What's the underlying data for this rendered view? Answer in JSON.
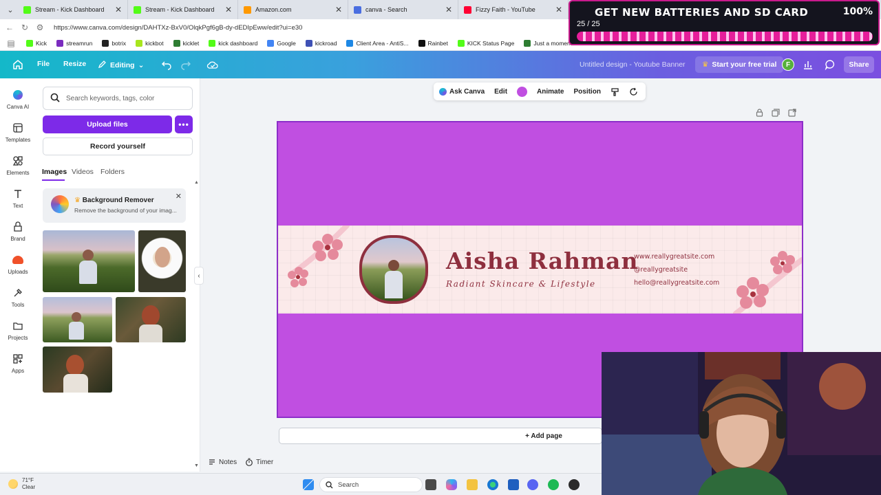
{
  "browser": {
    "tabs": [
      {
        "title": "Stream - Kick Dashboard",
        "color": "#53fc18"
      },
      {
        "title": "Stream - Kick Dashboard",
        "color": "#53fc18"
      },
      {
        "title": "Amazon.com",
        "color": "#ff9900"
      },
      {
        "title": "canva - Search",
        "color": "#4a6ee0"
      },
      {
        "title": "Fizzy Faith - YouTube",
        "color": "#ff0033"
      }
    ],
    "url": "https://www.canva.com/design/DAHTXz-BxV0/OlqkPgf6gB-dy-dEDIpEww/edit?ui=e30",
    "bookmarks": [
      {
        "label": "Kick",
        "color": "#53fc18"
      },
      {
        "label": "streamrun",
        "color": "#7b2cbf"
      },
      {
        "label": "botrix",
        "color": "#222222"
      },
      {
        "label": "kickbot",
        "color": "#a8e61d"
      },
      {
        "label": "kicklet",
        "color": "#2e7d32"
      },
      {
        "label": "kick dashboard",
        "color": "#53fc18"
      },
      {
        "label": "Google",
        "color": "#4285f4"
      },
      {
        "label": "kickroad",
        "color": "#3f51b5"
      },
      {
        "label": "Client Area - AntiS...",
        "color": "#1e88e5"
      },
      {
        "label": "Rainbet",
        "color": "#111111"
      },
      {
        "label": "KICK Status Page",
        "color": "#53fc18"
      },
      {
        "label": "Just a moment...",
        "color": "#2e7d32"
      }
    ]
  },
  "overlay": {
    "headline": "GET NEW BATTERIES AND SD CARD",
    "percent": "100%",
    "count": "25 / 25",
    "progress": 1.0
  },
  "header": {
    "file": "File",
    "resize": "Resize",
    "editing": "Editing",
    "design_title": "Untitled design - Youtube Banner",
    "trial": "Start your free trial",
    "avatar_initial": "F",
    "share": "Share"
  },
  "rail": [
    {
      "label": "Canva AI",
      "icon": "canva-ai-icon"
    },
    {
      "label": "Templates",
      "icon": "templates-icon"
    },
    {
      "label": "Elements",
      "icon": "elements-icon"
    },
    {
      "label": "Text",
      "icon": "text-icon"
    },
    {
      "label": "Brand",
      "icon": "brand-icon"
    },
    {
      "label": "Uploads",
      "icon": "uploads-icon"
    },
    {
      "label": "Tools",
      "icon": "tools-icon"
    },
    {
      "label": "Projects",
      "icon": "projects-icon"
    },
    {
      "label": "Apps",
      "icon": "apps-icon"
    }
  ],
  "panel": {
    "search_placeholder": "Search keywords, tags, color",
    "upload": "Upload files",
    "record": "Record yourself",
    "tabs": [
      "Images",
      "Videos",
      "Folders"
    ],
    "bg_remover_title": "Background Remover",
    "bg_remover_desc": "Remove the background of your imag..."
  },
  "toolbar": {
    "ask": "Ask Canva",
    "edit": "Edit",
    "swatch": "#c04fe1",
    "animate": "Animate",
    "position": "Position"
  },
  "banner": {
    "name": "Aisha Rahman",
    "tagline": "Radiant Skincare & Lifestyle",
    "contacts": [
      "www.reallygreatsite.com",
      "@reallygreatsite",
      "hello@reallygreatsite.com"
    ],
    "bg_color": "#c04fe1",
    "accent_color": "#8e2f3e"
  },
  "canvas_footer": {
    "add_page": "+ Add page",
    "notes": "Notes",
    "timer": "Timer"
  },
  "taskbar": {
    "temp": "71°F",
    "condition": "Clear",
    "search": "Search"
  }
}
